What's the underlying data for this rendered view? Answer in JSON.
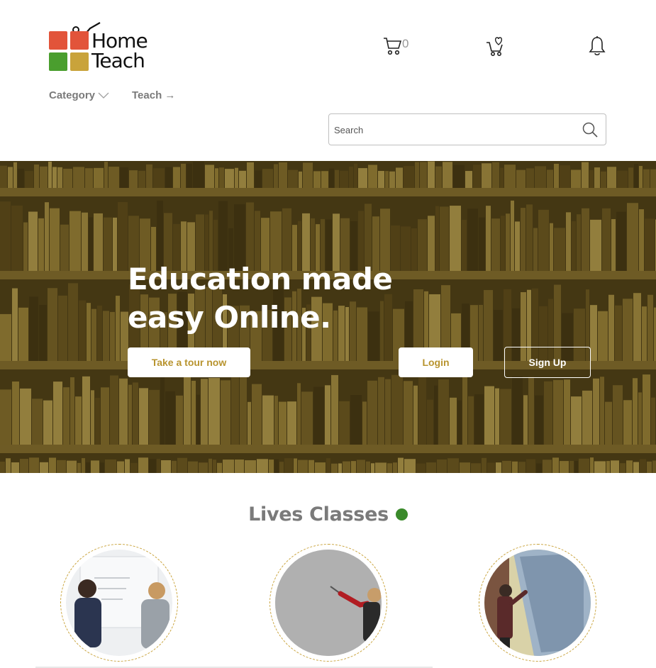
{
  "brand": {
    "name_line1": "Home",
    "name_line2": "Teach",
    "colors": {
      "red": "#e2543a",
      "orange": "#e3a93a",
      "green": "#4a9e2e",
      "gold": "#c9a33b"
    }
  },
  "header": {
    "cart": {
      "icon": "shopping-cart-icon",
      "count": "0"
    },
    "wishlist": {
      "icon": "cart-heart-icon"
    },
    "notifications": {
      "icon": "bell-icon"
    }
  },
  "nav": {
    "category_label": "Category",
    "teach_label": "Teach →"
  },
  "search": {
    "placeholder": "Search",
    "icon": "search-icon"
  },
  "hero": {
    "title_line1": "Education made",
    "title_line2": "easy Online.",
    "tour_button": "Take a tour now",
    "login_button": "Login",
    "signup_button": "Sign Up",
    "accent": "#b8942f"
  },
  "live": {
    "title": "Lives Classes",
    "dot_color": "#3a8a2a",
    "classes": [
      {
        "photo": "teachers-at-whiteboard"
      },
      {
        "photo": "student-pointing-at-board"
      },
      {
        "photo": "teacher-writing-on-board"
      }
    ]
  }
}
